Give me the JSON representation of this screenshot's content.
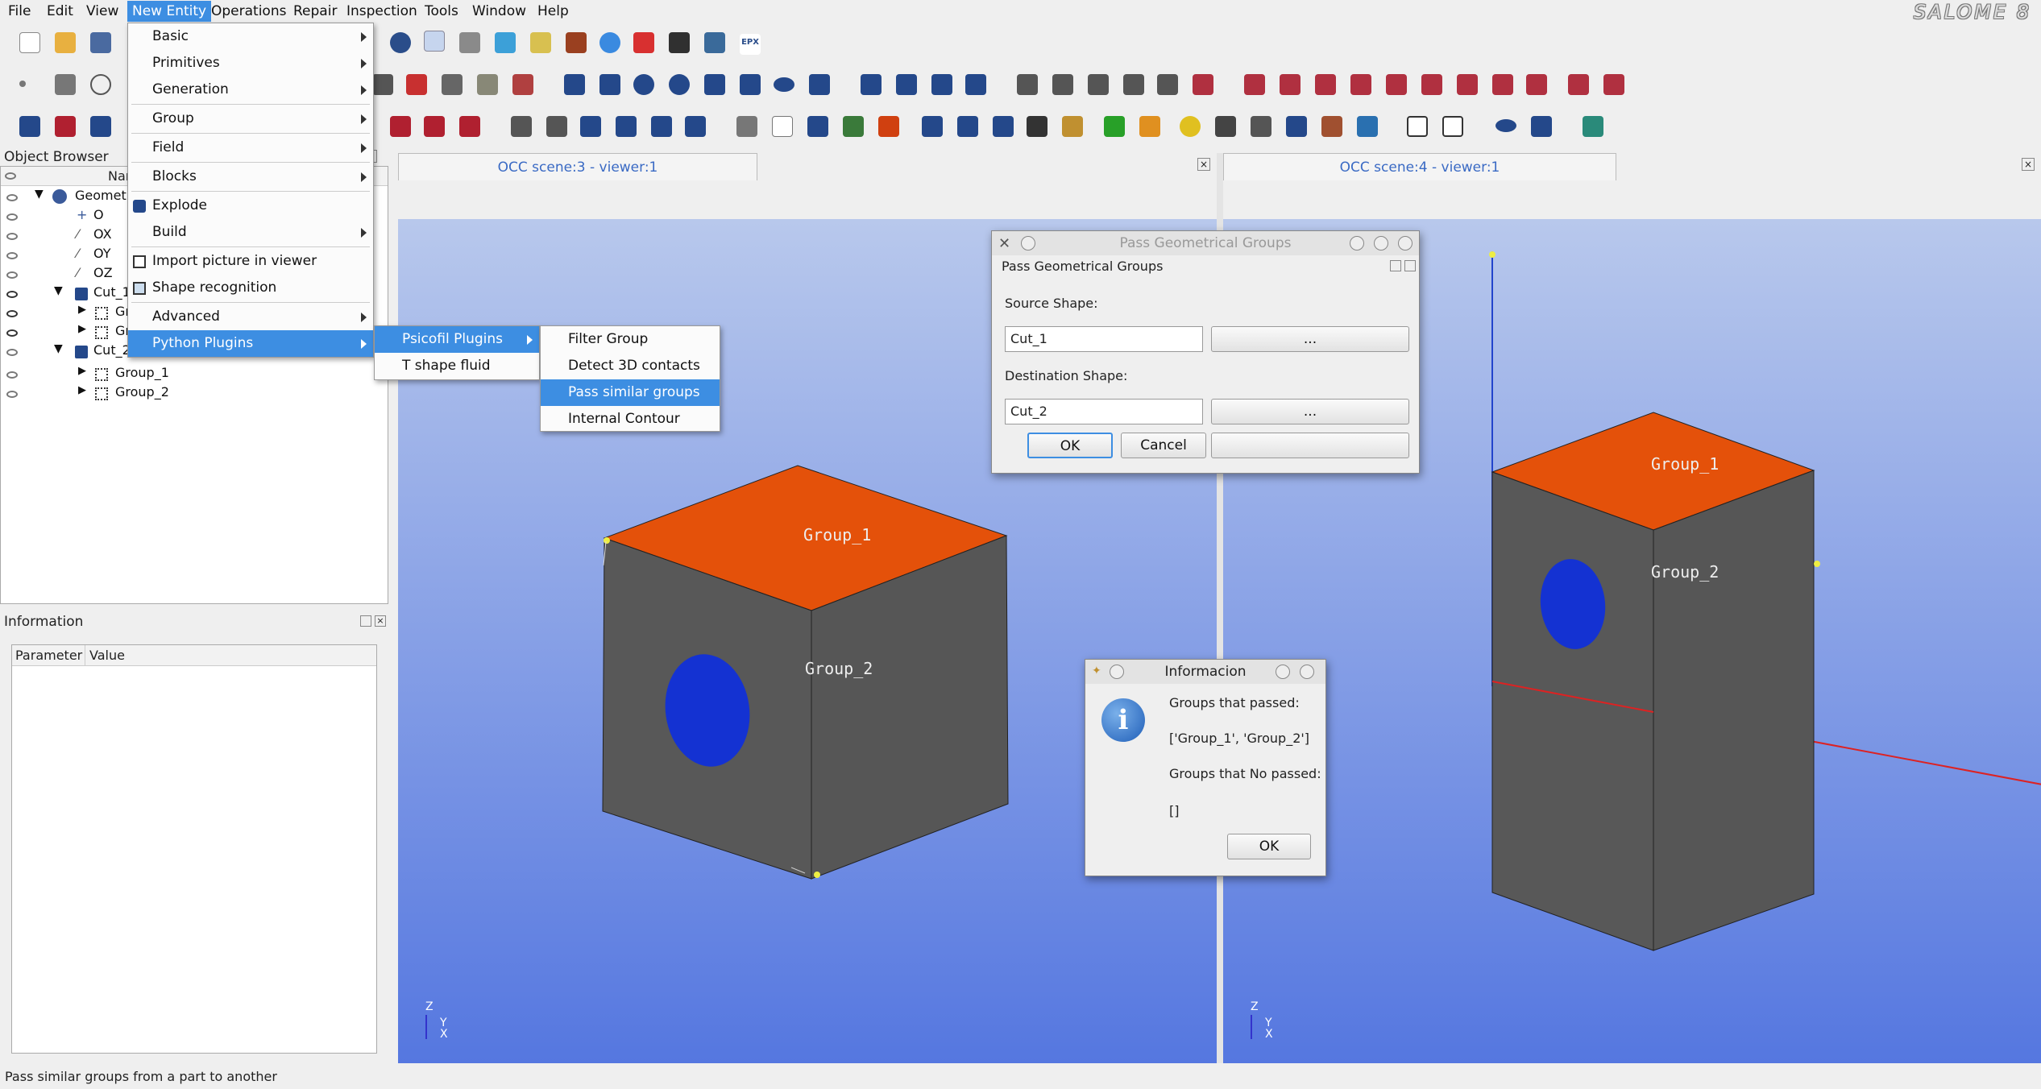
{
  "menubar": {
    "items": [
      "File",
      "Edit",
      "View",
      "New Entity",
      "Operations",
      "Repair",
      "Inspection",
      "Tools",
      "Window",
      "Help"
    ],
    "active": "New Entity",
    "logo": "SALOME 8"
  },
  "new_entity_menu": {
    "items": [
      "Basic",
      "Primitives",
      "Generation",
      "Group",
      "Field",
      "Blocks",
      "Explode",
      "Build",
      "Import picture in viewer",
      "Shape recognition",
      "Advanced",
      "Python Plugins"
    ],
    "highlighted": "Python Plugins"
  },
  "python_plugins_menu": {
    "items": [
      "Psicofil Plugins",
      "T shape fluid"
    ],
    "highlighted": "Psicofil Plugins"
  },
  "psicofil_menu": {
    "items": [
      "Filter Group",
      "Detect 3D contacts",
      "Pass similar groups",
      "Internal Contour"
    ],
    "highlighted": "Pass similar groups"
  },
  "object_browser": {
    "title": "Object Browser",
    "header": "Nam",
    "items": [
      "Geometry",
      "O",
      "OX",
      "OY",
      "OZ",
      "Cut_1",
      "Gr",
      "Gr",
      "Cut_2",
      "Group_1",
      "Group_2"
    ]
  },
  "information": {
    "title": "Information",
    "col_param": "Parameter",
    "col_value": "Value"
  },
  "viewers": [
    {
      "tab": "OCC scene:3 - viewer:1"
    },
    {
      "tab": "OCC scene:4 - viewer:1"
    }
  ],
  "scene_labels": {
    "left_top": "Group_1",
    "left_side": "Group_2",
    "right_top": "Group_1",
    "right_side": "Group_2",
    "axis_z": "Z",
    "axis_y": "Y",
    "axis_x": "X"
  },
  "pass_dialog": {
    "window_title": "Pass Geometrical Groups",
    "title": "Pass Geometrical Groups",
    "source_label": "Source Shape:",
    "source_value": "Cut_1",
    "dest_label": "Destination Shape:",
    "dest_value": "Cut_2",
    "browse_label": "...",
    "ok": "OK",
    "cancel": "Cancel"
  },
  "info_dialog": {
    "title": "Informacion",
    "line1": "Groups that passed:",
    "line2": "['Group_1', 'Group_2']",
    "line3": "Groups that No passed:",
    "line4": "[]",
    "ok": "OK"
  },
  "statusbar": {
    "text": "Pass similar groups from a part to another"
  },
  "colors": {
    "accent": "#3d8ee2",
    "face_top": "#e4510a",
    "face_side": "#585858",
    "hole": "#1432d2"
  }
}
